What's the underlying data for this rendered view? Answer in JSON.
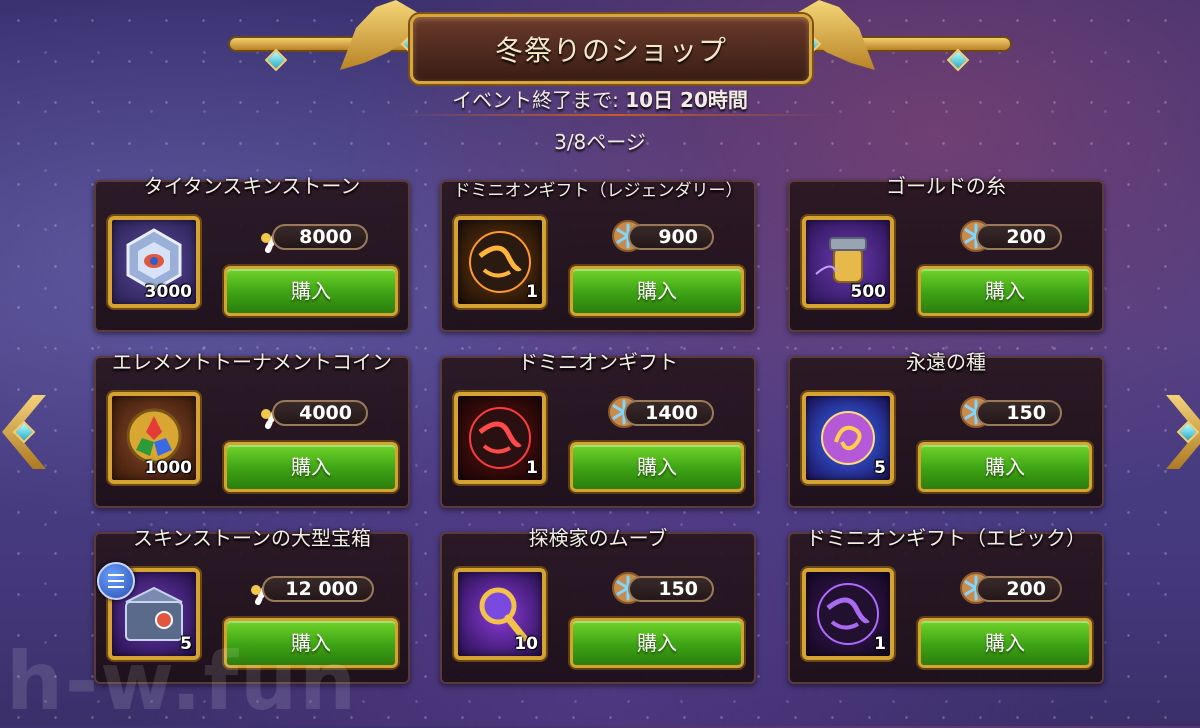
{
  "shop": {
    "title": "冬祭りのショップ",
    "timer_label": "イベント終了まで:",
    "timer_value": "10日 20時間",
    "page_indicator": "3/8ページ",
    "watermark": "h-w.fun"
  },
  "items": [
    {
      "title": "タイタンスキンストーン",
      "quantity": "3000",
      "currency": "candy-cane-icon",
      "price": "8000",
      "buy_label": "購入",
      "icon": "titan-skin-stone-icon"
    },
    {
      "title": "ドミニオンギフト（レジェンダリー）",
      "quantity": "1",
      "currency": "snowflake-cookie-icon",
      "price": "900",
      "buy_label": "購入",
      "icon": "dominion-gift-legendary-icon"
    },
    {
      "title": "ゴールドの糸",
      "quantity": "500",
      "currency": "snowflake-cookie-icon",
      "price": "200",
      "buy_label": "購入",
      "icon": "gold-thread-icon"
    },
    {
      "title": "エレメントトーナメントコイン",
      "quantity": "1000",
      "currency": "candy-cane-icon",
      "price": "4000",
      "buy_label": "購入",
      "icon": "element-tournament-coin-icon"
    },
    {
      "title": "ドミニオンギフト",
      "quantity": "1",
      "currency": "snowflake-cookie-icon",
      "price": "1400",
      "buy_label": "購入",
      "icon": "dominion-gift-icon"
    },
    {
      "title": "永遠の種",
      "quantity": "5",
      "currency": "snowflake-cookie-icon",
      "price": "150",
      "buy_label": "購入",
      "icon": "eternal-seed-icon"
    },
    {
      "title": "スキンストーンの大型宝箱",
      "quantity": "5",
      "currency": "candy-cane-icon",
      "price": "12 000",
      "buy_label": "購入",
      "icon": "large-skin-stone-chest-icon"
    },
    {
      "title": "探検家のムーブ",
      "quantity": "10",
      "currency": "snowflake-cookie-icon",
      "price": "150",
      "buy_label": "購入",
      "icon": "explorer-magnifier-icon"
    },
    {
      "title": "ドミニオンギフト（エピック）",
      "quantity": "1",
      "currency": "snowflake-cookie-icon",
      "price": "200",
      "buy_label": "購入",
      "icon": "dominion-gift-epic-icon"
    }
  ],
  "colors": {
    "buy_button": "#3da315",
    "frame_gold": "#d4a332",
    "background": "#463a7e"
  }
}
